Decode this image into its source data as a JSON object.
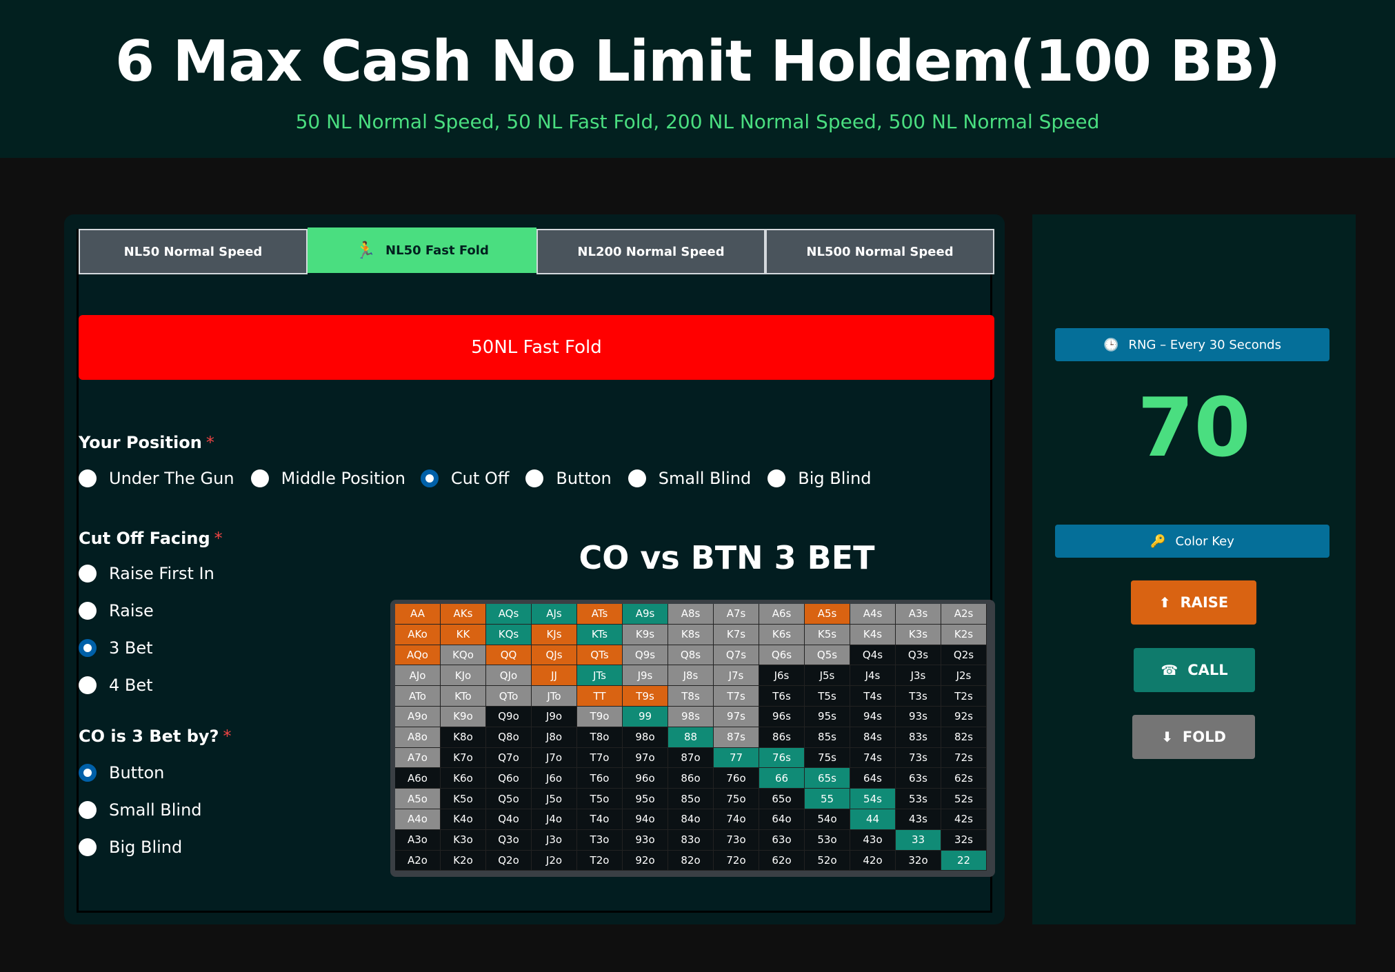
{
  "header": {
    "title": "6 Max Cash No Limit Holdem(100 BB)",
    "subtitle": "50 NL Normal Speed, 50 NL Fast Fold, 200 NL Normal Speed, 500 NL Normal Speed"
  },
  "tabs": [
    {
      "label": "NL50 Normal Speed",
      "active": false
    },
    {
      "label": "NL50 Fast Fold",
      "active": true,
      "icon": "running-man-icon"
    },
    {
      "label": "NL200 Normal Speed",
      "active": false
    },
    {
      "label": "NL500 Normal Speed",
      "active": false
    }
  ],
  "banner": "50NL Fast Fold",
  "position": {
    "label": "Your Position",
    "required": "*",
    "options": [
      "Under The Gun",
      "Middle Position",
      "Cut Off",
      "Button",
      "Small Blind",
      "Big Blind"
    ],
    "selected": "Cut Off"
  },
  "facing": {
    "label": "Cut Off Facing",
    "required": "*",
    "options": [
      "Raise First In",
      "Raise",
      "3 Bet",
      "4 Bet"
    ],
    "selected": "3 Bet"
  },
  "threebet_by": {
    "label": "CO is 3 Bet by?",
    "required": "*",
    "options": [
      "Button",
      "Small Blind",
      "Big Blind"
    ],
    "selected": "Button"
  },
  "range": {
    "title": "CO vs BTN 3 BET",
    "rows": [
      [
        [
          "AA",
          "r"
        ],
        [
          "AKs",
          "r"
        ],
        [
          "AQs",
          "c"
        ],
        [
          "AJs",
          "c"
        ],
        [
          "ATs",
          "r"
        ],
        [
          "A9s",
          "c"
        ],
        [
          "A8s",
          "f"
        ],
        [
          "A7s",
          "f"
        ],
        [
          "A6s",
          "f"
        ],
        [
          "A5s",
          "r"
        ],
        [
          "A4s",
          "f"
        ],
        [
          "A3s",
          "f"
        ],
        [
          "A2s",
          "f"
        ]
      ],
      [
        [
          "AKo",
          "r"
        ],
        [
          "KK",
          "r"
        ],
        [
          "KQs",
          "c"
        ],
        [
          "KJs",
          "r"
        ],
        [
          "KTs",
          "c"
        ],
        [
          "K9s",
          "f"
        ],
        [
          "K8s",
          "f"
        ],
        [
          "K7s",
          "f"
        ],
        [
          "K6s",
          "f"
        ],
        [
          "K5s",
          "f"
        ],
        [
          "K4s",
          "f"
        ],
        [
          "K3s",
          "f"
        ],
        [
          "K2s",
          "f"
        ]
      ],
      [
        [
          "AQo",
          "r"
        ],
        [
          "KQo",
          "f"
        ],
        [
          "QQ",
          "r"
        ],
        [
          "QJs",
          "r"
        ],
        [
          "QTs",
          "r"
        ],
        [
          "Q9s",
          "f"
        ],
        [
          "Q8s",
          "f"
        ],
        [
          "Q7s",
          "f"
        ],
        [
          "Q6s",
          "f"
        ],
        [
          "Q5s",
          "f"
        ],
        [
          "Q4s",
          "n"
        ],
        [
          "Q3s",
          "n"
        ],
        [
          "Q2s",
          "n"
        ]
      ],
      [
        [
          "AJo",
          "f"
        ],
        [
          "KJo",
          "f"
        ],
        [
          "QJo",
          "f"
        ],
        [
          "JJ",
          "r"
        ],
        [
          "JTs",
          "c"
        ],
        [
          "J9s",
          "f"
        ],
        [
          "J8s",
          "f"
        ],
        [
          "J7s",
          "f"
        ],
        [
          "J6s",
          "n"
        ],
        [
          "J5s",
          "n"
        ],
        [
          "J4s",
          "n"
        ],
        [
          "J3s",
          "n"
        ],
        [
          "J2s",
          "n"
        ]
      ],
      [
        [
          "ATo",
          "f"
        ],
        [
          "KTo",
          "f"
        ],
        [
          "QTo",
          "f"
        ],
        [
          "JTo",
          "f"
        ],
        [
          "TT",
          "r"
        ],
        [
          "T9s",
          "r"
        ],
        [
          "T8s",
          "f"
        ],
        [
          "T7s",
          "f"
        ],
        [
          "T6s",
          "n"
        ],
        [
          "T5s",
          "n"
        ],
        [
          "T4s",
          "n"
        ],
        [
          "T3s",
          "n"
        ],
        [
          "T2s",
          "n"
        ]
      ],
      [
        [
          "A9o",
          "f"
        ],
        [
          "K9o",
          "f"
        ],
        [
          "Q9o",
          "n"
        ],
        [
          "J9o",
          "n"
        ],
        [
          "T9o",
          "f"
        ],
        [
          "99",
          "c"
        ],
        [
          "98s",
          "f"
        ],
        [
          "97s",
          "f"
        ],
        [
          "96s",
          "n"
        ],
        [
          "95s",
          "n"
        ],
        [
          "94s",
          "n"
        ],
        [
          "93s",
          "n"
        ],
        [
          "92s",
          "n"
        ]
      ],
      [
        [
          "A8o",
          "f"
        ],
        [
          "K8o",
          "n"
        ],
        [
          "Q8o",
          "n"
        ],
        [
          "J8o",
          "n"
        ],
        [
          "T8o",
          "n"
        ],
        [
          "98o",
          "n"
        ],
        [
          "88",
          "c"
        ],
        [
          "87s",
          "f"
        ],
        [
          "86s",
          "n"
        ],
        [
          "85s",
          "n"
        ],
        [
          "84s",
          "n"
        ],
        [
          "83s",
          "n"
        ],
        [
          "82s",
          "n"
        ]
      ],
      [
        [
          "A7o",
          "f"
        ],
        [
          "K7o",
          "n"
        ],
        [
          "Q7o",
          "n"
        ],
        [
          "J7o",
          "n"
        ],
        [
          "T7o",
          "n"
        ],
        [
          "97o",
          "n"
        ],
        [
          "87o",
          "n"
        ],
        [
          "77",
          "c"
        ],
        [
          "76s",
          "c"
        ],
        [
          "75s",
          "n"
        ],
        [
          "74s",
          "n"
        ],
        [
          "73s",
          "n"
        ],
        [
          "72s",
          "n"
        ]
      ],
      [
        [
          "A6o",
          "n"
        ],
        [
          "K6o",
          "n"
        ],
        [
          "Q6o",
          "n"
        ],
        [
          "J6o",
          "n"
        ],
        [
          "T6o",
          "n"
        ],
        [
          "96o",
          "n"
        ],
        [
          "86o",
          "n"
        ],
        [
          "76o",
          "n"
        ],
        [
          "66",
          "c"
        ],
        [
          "65s",
          "c"
        ],
        [
          "64s",
          "n"
        ],
        [
          "63s",
          "n"
        ],
        [
          "62s",
          "n"
        ]
      ],
      [
        [
          "A5o",
          "f"
        ],
        [
          "K5o",
          "n"
        ],
        [
          "Q5o",
          "n"
        ],
        [
          "J5o",
          "n"
        ],
        [
          "T5o",
          "n"
        ],
        [
          "95o",
          "n"
        ],
        [
          "85o",
          "n"
        ],
        [
          "75o",
          "n"
        ],
        [
          "65o",
          "n"
        ],
        [
          "55",
          "c"
        ],
        [
          "54s",
          "c"
        ],
        [
          "53s",
          "n"
        ],
        [
          "52s",
          "n"
        ]
      ],
      [
        [
          "A4o",
          "f"
        ],
        [
          "K4o",
          "n"
        ],
        [
          "Q4o",
          "n"
        ],
        [
          "J4o",
          "n"
        ],
        [
          "T4o",
          "n"
        ],
        [
          "94o",
          "n"
        ],
        [
          "84o",
          "n"
        ],
        [
          "74o",
          "n"
        ],
        [
          "64o",
          "n"
        ],
        [
          "54o",
          "n"
        ],
        [
          "44",
          "c"
        ],
        [
          "43s",
          "n"
        ],
        [
          "42s",
          "n"
        ]
      ],
      [
        [
          "A3o",
          "n"
        ],
        [
          "K3o",
          "n"
        ],
        [
          "Q3o",
          "n"
        ],
        [
          "J3o",
          "n"
        ],
        [
          "T3o",
          "n"
        ],
        [
          "93o",
          "n"
        ],
        [
          "83o",
          "n"
        ],
        [
          "73o",
          "n"
        ],
        [
          "63o",
          "n"
        ],
        [
          "53o",
          "n"
        ],
        [
          "43o",
          "n"
        ],
        [
          "33",
          "c"
        ],
        [
          "32s",
          "n"
        ]
      ],
      [
        [
          "A2o",
          "n"
        ],
        [
          "K2o",
          "n"
        ],
        [
          "Q2o",
          "n"
        ],
        [
          "J2o",
          "n"
        ],
        [
          "T2o",
          "n"
        ],
        [
          "92o",
          "n"
        ],
        [
          "82o",
          "n"
        ],
        [
          "72o",
          "n"
        ],
        [
          "62o",
          "n"
        ],
        [
          "52o",
          "n"
        ],
        [
          "42o",
          "n"
        ],
        [
          "32o",
          "n"
        ],
        [
          "22",
          "c"
        ]
      ]
    ]
  },
  "sidebar": {
    "rng_label": "RNG – Every 30 Seconds",
    "rng_value": "70",
    "color_key_label": "Color Key",
    "raise_label": "RAISE",
    "call_label": "CALL",
    "fold_label": "FOLD"
  },
  "colors": {
    "raise": "#d96312",
    "call": "#108b76",
    "mixed": "#8c8c8c",
    "fold": "#0b1114",
    "accent": "#4ade80",
    "banner": "#ff0000"
  }
}
